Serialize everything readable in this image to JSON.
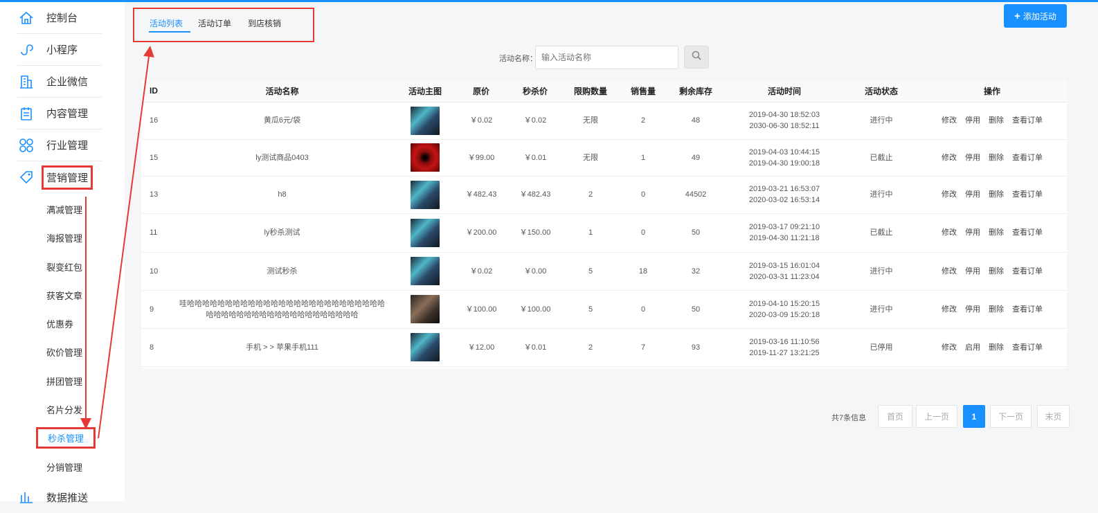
{
  "sidebar": {
    "items": [
      {
        "label": "控制台",
        "icon": "home-icon"
      },
      {
        "label": "小程序",
        "icon": "mini-program-icon"
      },
      {
        "label": "企业微信",
        "icon": "building-icon"
      },
      {
        "label": "内容管理",
        "icon": "clipboard-icon"
      },
      {
        "label": "行业管理",
        "icon": "grid-icon"
      },
      {
        "label": "营销管理",
        "icon": "tag-icon"
      },
      {
        "label": "数据推送",
        "icon": "data-push-icon"
      }
    ],
    "sub_items": [
      "满减管理",
      "海报管理",
      "裂变红包",
      "获客文章",
      "优惠券",
      "砍价管理",
      "拼团管理",
      "名片分发",
      "秒杀管理",
      "分销管理"
    ]
  },
  "tabs": [
    "活动列表",
    "活动订单",
    "到店核销"
  ],
  "add_button": {
    "icon": "plus-icon",
    "label": "添加活动"
  },
  "search": {
    "label": "活动名称：",
    "placeholder": "输入活动名称",
    "button_icon": "search-icon"
  },
  "table": {
    "columns": [
      "ID",
      "活动名称",
      "活动主图",
      "原价",
      "秒杀价",
      "限购数量",
      "销售量",
      "剩余库存",
      "活动时间",
      "活动状态",
      "操作"
    ],
    "rows": [
      {
        "id": "16",
        "name": "黄瓜6元/袋",
        "thumb": "anime",
        "price": "￥0.02",
        "sale_price": "￥0.02",
        "limit": "无限",
        "sold": "2",
        "stock": "48",
        "time_start": "2019-04-30 18:52:03",
        "time_end": "2030-06-30 18:52:11",
        "status": "进行中",
        "ops": [
          "修改",
          "停用",
          "删除",
          "查看订单"
        ]
      },
      {
        "id": "15",
        "name": "ly测试商品0403",
        "thumb": "red",
        "price": "￥99.00",
        "sale_price": "￥0.01",
        "limit": "无限",
        "sold": "1",
        "stock": "49",
        "time_start": "2019-04-03 10:44:15",
        "time_end": "2019-04-30 19:00:18",
        "status": "已截止",
        "ops": [
          "修改",
          "停用",
          "删除",
          "查看订单"
        ]
      },
      {
        "id": "13",
        "name": "h8",
        "thumb": "anime",
        "price": "￥482.43",
        "sale_price": "￥482.43",
        "limit": "2",
        "sold": "0",
        "stock": "44502",
        "time_start": "2019-03-21 16:53:07",
        "time_end": "2020-03-02 16:53:14",
        "status": "进行中",
        "ops": [
          "修改",
          "停用",
          "删除",
          "查看订单"
        ]
      },
      {
        "id": "11",
        "name": "ly秒杀测试",
        "thumb": "anime",
        "price": "￥200.00",
        "sale_price": "￥150.00",
        "limit": "1",
        "sold": "0",
        "stock": "50",
        "time_start": "2019-03-17 09:21:10",
        "time_end": "2019-04-30 11:21:18",
        "status": "已截止",
        "ops": [
          "修改",
          "停用",
          "删除",
          "查看订单"
        ]
      },
      {
        "id": "10",
        "name": "测试秒杀",
        "thumb": "anime",
        "price": "￥0.02",
        "sale_price": "￥0.00",
        "limit": "5",
        "sold": "18",
        "stock": "32",
        "time_start": "2019-03-15 16:01:04",
        "time_end": "2020-03-31 11:23:04",
        "status": "进行中",
        "ops": [
          "修改",
          "停用",
          "删除",
          "查看订单"
        ]
      },
      {
        "id": "9",
        "name": "哇哈哈哈哈哈哈哈哈哈哈哈哈哈哈哈哈哈哈哈哈哈哈哈哈哈哈哈哈哈哈哈哈哈哈哈哈哈哈哈哈哈哈哈哈哈哈",
        "thumb": "dark",
        "price": "￥100.00",
        "sale_price": "￥100.00",
        "limit": "5",
        "sold": "0",
        "stock": "50",
        "time_start": "2019-04-10 15:20:15",
        "time_end": "2020-03-09 15:20:18",
        "status": "进行中",
        "ops": [
          "修改",
          "停用",
          "删除",
          "查看订单"
        ]
      },
      {
        "id": "8",
        "name": "手机 > > 苹果手机111",
        "thumb": "anime",
        "price": "￥12.00",
        "sale_price": "￥0.01",
        "limit": "2",
        "sold": "7",
        "stock": "93",
        "time_start": "2019-03-16 11:10:56",
        "time_end": "2019-11-27 13:21:25",
        "status": "已停用",
        "ops": [
          "修改",
          "启用",
          "删除",
          "查看订单"
        ]
      }
    ]
  },
  "pagination": {
    "info": "共7条信息",
    "first": "首页",
    "prev": "上一页",
    "current": "1",
    "next": "下一页",
    "last": "末页"
  },
  "colors": {
    "accent": "#1890ff",
    "highlight": "#e53935"
  }
}
